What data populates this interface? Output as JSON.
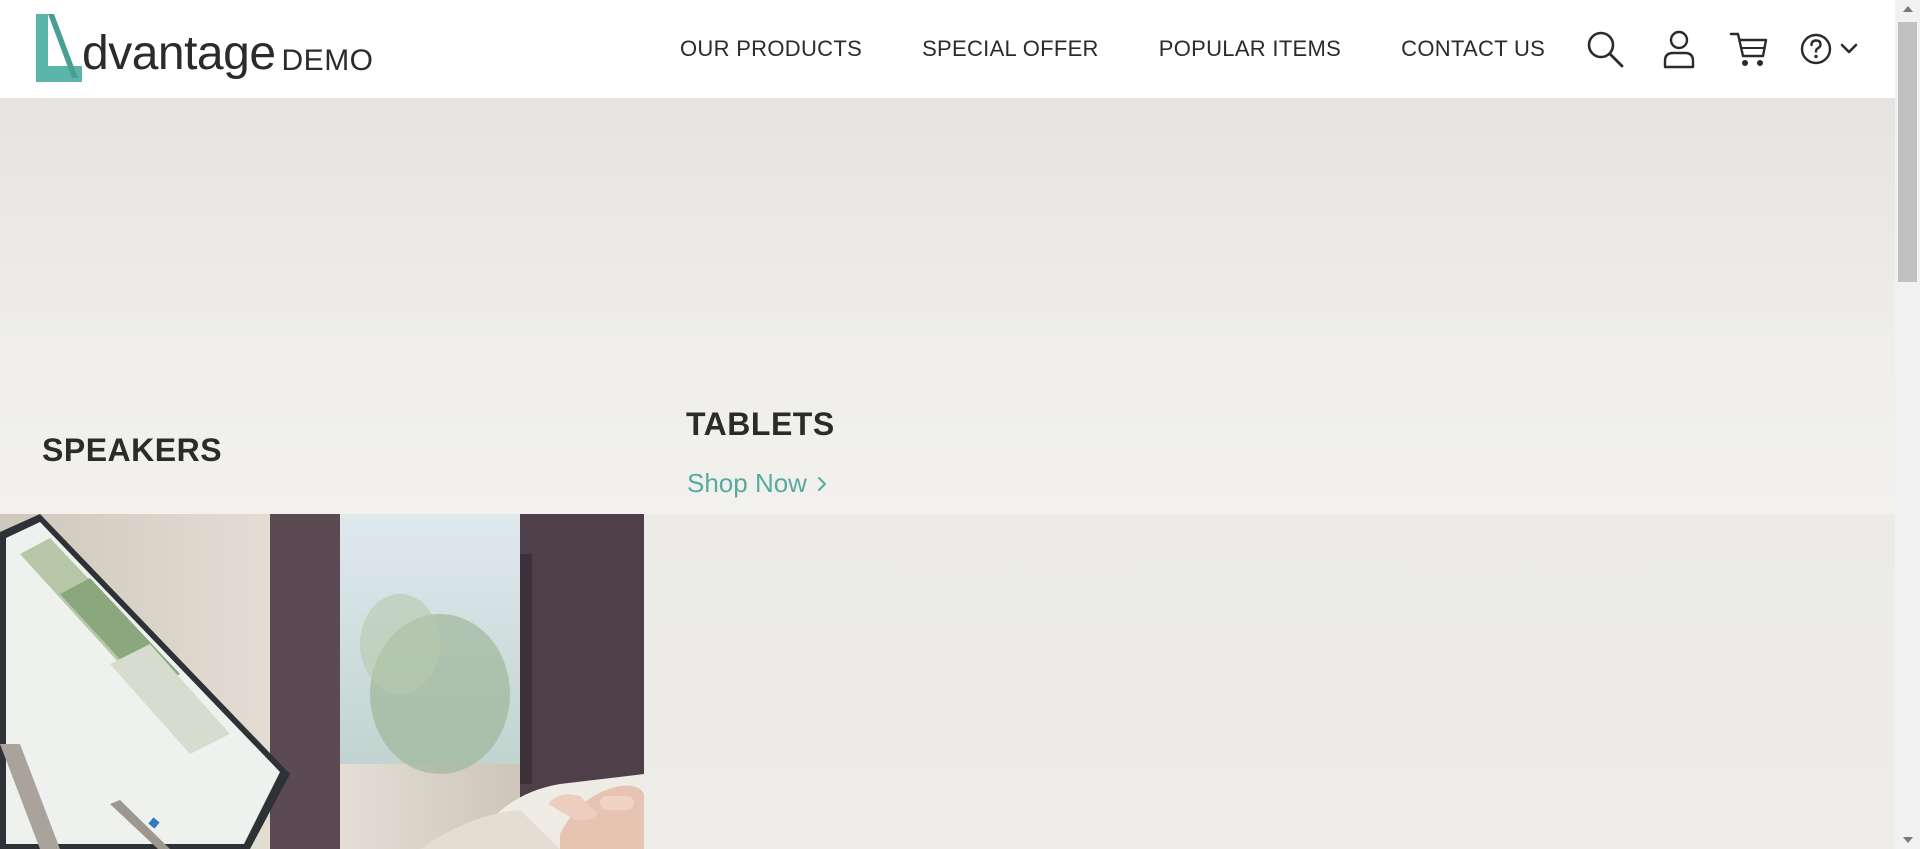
{
  "brand": {
    "name": "dvantage",
    "suffix": "DEMO",
    "accent": "#5bb5a8"
  },
  "nav": {
    "items": [
      {
        "label": "OUR PRODUCTS"
      },
      {
        "label": "SPECIAL OFFER"
      },
      {
        "label": "POPULAR ITEMS"
      },
      {
        "label": "CONTACT US"
      }
    ]
  },
  "header_icons": [
    "search-icon",
    "user-icon",
    "cart-icon",
    "help-icon",
    "chevron-down-icon"
  ],
  "hero": {
    "speakers_title": "SPEAKERS",
    "tablets_title": "TABLETS",
    "tablets_cta": "Shop Now",
    "cta_color": "#58aaa0"
  }
}
